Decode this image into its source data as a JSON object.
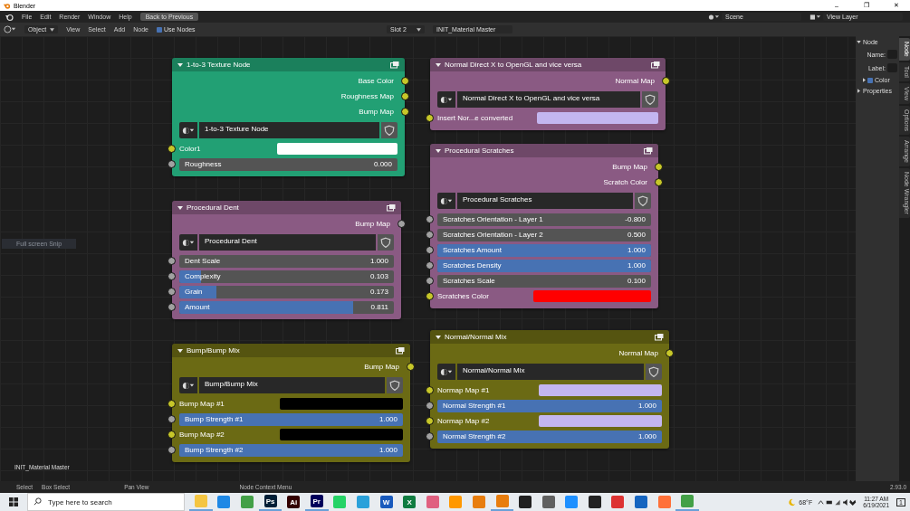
{
  "window": {
    "title": "Blender",
    "controls": [
      "–",
      "❐",
      "✕"
    ]
  },
  "menubar": {
    "items": [
      "File",
      "Edit",
      "Render",
      "Window",
      "Help"
    ],
    "back_button": "Back to Previous"
  },
  "scene": {
    "scene": "Scene",
    "view_layer": "View Layer"
  },
  "header": {
    "mode": "Object",
    "menus": [
      "View",
      "Select",
      "Add",
      "Node"
    ],
    "use_nodes": {
      "label": "Use Nodes",
      "checked": true
    },
    "slot": "Slot 2",
    "material": "INIT_Material Master"
  },
  "canvas": {
    "label": "INIT_Material Master",
    "ghost": "Full screen Snip"
  },
  "nodes": [
    {
      "title": "1-to-3 Texture Node",
      "color": "#22a074",
      "rows": [
        {
          "kind": "output",
          "label": "Base Color",
          "color_socket": true
        },
        {
          "kind": "output",
          "label": "Roughness Map",
          "color_socket": true
        },
        {
          "kind": "output",
          "label": "Bump Map",
          "color_socket": true
        },
        {
          "kind": "group",
          "label": "1-to-3 Texture Node"
        },
        {
          "kind": "color",
          "label": "Color1",
          "color_socket": true,
          "color": "#ffffff"
        },
        {
          "kind": "value",
          "label": "Roughness",
          "value": "0.000",
          "color_socket": false
        }
      ]
    },
    {
      "title": "Procedural Dent",
      "color": "#8a5a83",
      "rows": [
        {
          "kind": "output",
          "label": "Bump Map",
          "color_socket": false
        },
        {
          "kind": "group",
          "label": "Procedural Dent"
        },
        {
          "kind": "value",
          "label": "Dent Scale",
          "value": "1.000",
          "color_socket": false
        },
        {
          "kind": "factor",
          "label": "Complexity",
          "value": "0.103",
          "level": 0.103,
          "color_socket": false
        },
        {
          "kind": "factor",
          "label": "Grain",
          "value": "0.173",
          "level": 0.173,
          "color_socket": false
        },
        {
          "kind": "factor",
          "label": "Amount",
          "value": "0.811",
          "level": 0.811,
          "color_socket": false
        }
      ]
    },
    {
      "title": "Bump/Bump Mix",
      "color": "#6b6a14",
      "rows": [
        {
          "kind": "output",
          "label": "Bump Map",
          "color_socket": true
        },
        {
          "kind": "group",
          "label": "Bump/Bump Mix"
        },
        {
          "kind": "color",
          "label": "Bump Map #1",
          "color_socket": true,
          "color": "#000000"
        },
        {
          "kind": "factor",
          "label": "Bump Strength #1",
          "value": "1.000",
          "level": 1,
          "color_socket": false
        },
        {
          "kind": "color",
          "label": "Bump Map #2",
          "color_socket": true,
          "color": "#000000"
        },
        {
          "kind": "factor",
          "label": "Bump Strength #2",
          "value": "1.000",
          "level": 1,
          "color_socket": false
        }
      ]
    },
    {
      "title": "Normal Direct X to OpenGL and  vice versa",
      "color": "#8a5a83",
      "rows": [
        {
          "kind": "output",
          "label": "Normal Map",
          "color_socket": true
        },
        {
          "kind": "group",
          "label": "Normal Direct X to OpenGL and  vice versa"
        },
        {
          "kind": "color",
          "label": "Insert Nor...e converted",
          "color_socket": true,
          "color": "#c3b6f0"
        }
      ]
    },
    {
      "title": "Procedural Scratches",
      "color": "#8a5a83",
      "rows": [
        {
          "kind": "output",
          "label": "Bump Map",
          "color_socket": true
        },
        {
          "kind": "output",
          "label": "Scratch Color",
          "color_socket": true
        },
        {
          "kind": "group",
          "label": "Procedural Scratches"
        },
        {
          "kind": "value",
          "label": "Scratches Orientation - Layer 1",
          "value": "-0.800",
          "color_socket": false
        },
        {
          "kind": "value",
          "label": "Scratches Orientation - Layer 2",
          "value": "0.500",
          "color_socket": false
        },
        {
          "kind": "factor",
          "label": "Scratches Amount",
          "value": "1.000",
          "level": 1,
          "color_socket": false
        },
        {
          "kind": "factor",
          "label": "Scratches Density",
          "value": "1.000",
          "level": 1,
          "color_socket": false
        },
        {
          "kind": "value",
          "label": "Scratches Scale",
          "value": "0.100",
          "color_socket": false
        },
        {
          "kind": "color",
          "label": "Scratches Color",
          "color_socket": true,
          "color": "#ff0000"
        }
      ]
    },
    {
      "title": "Normal/Normal Mix",
      "color": "#6b6a14",
      "rows": [
        {
          "kind": "output",
          "label": "Normal Map",
          "color_socket": true
        },
        {
          "kind": "group",
          "label": "Normal/Normal Mix"
        },
        {
          "kind": "color",
          "label": "Normap Map #1",
          "color_socket": true,
          "color": "#c3b6f0"
        },
        {
          "kind": "factor",
          "label": "Normal Strength #1",
          "value": "1.000",
          "level": 1,
          "color_socket": false
        },
        {
          "kind": "color",
          "label": "Normap Map #2",
          "color_socket": true,
          "color": "#c3b6f0"
        },
        {
          "kind": "factor",
          "label": "Normal Strength #2",
          "value": "1.000",
          "level": 1,
          "color_socket": false
        }
      ]
    }
  ],
  "sidebar": {
    "section": {
      "label": "Node",
      "expanded": true
    },
    "name_label": "Name:",
    "label_label": "Label:",
    "color": {
      "label": "Color",
      "checked": true,
      "expanded": false
    },
    "properties": {
      "label": "Properties",
      "expanded": false
    },
    "tabs": [
      {
        "label": "Node",
        "selected": true
      },
      {
        "label": "Tool",
        "selected": false
      },
      {
        "label": "View",
        "selected": false
      },
      {
        "label": "Options",
        "selected": false
      },
      {
        "label": "Arrange",
        "selected": false
      },
      {
        "label": "Node Wrangler",
        "selected": false
      }
    ]
  },
  "status_bar": {
    "hints": [
      "Select",
      "Box Select",
      "Pan View",
      "Node Context Menu"
    ],
    "version": "2.93.0"
  },
  "taskbar": {
    "search": {
      "placeholder": "Type here to search"
    },
    "apps": [
      {
        "color": "#f4c542",
        "open": true
      },
      {
        "color": "#1e88e5",
        "open": false
      },
      {
        "color": "#43a047",
        "open": false
      },
      {
        "color": "#001e36",
        "label": "Ps",
        "open": true
      },
      {
        "color": "#330000",
        "label": "Ai",
        "open": false
      },
      {
        "color": "#00005b",
        "label": "Pr",
        "open": true
      },
      {
        "color": "#25d366",
        "open": false
      },
      {
        "color": "#2aa1da",
        "open": false
      },
      {
        "color": "#185abd",
        "label": "W",
        "open": false
      },
      {
        "color": "#107c41",
        "label": "X",
        "open": false
      },
      {
        "color": "#e06080",
        "open": false
      },
      {
        "color": "#ff9800",
        "open": false
      },
      {
        "color": "#e87d0d",
        "open": false
      },
      {
        "color": "#e87d0d",
        "open": true
      },
      {
        "color": "#202020",
        "open": false
      },
      {
        "color": "#606060",
        "open": false
      },
      {
        "color": "#1e90ff",
        "open": false
      },
      {
        "color": "#222222",
        "open": false
      },
      {
        "color": "#dd3333",
        "open": false
      },
      {
        "color": "#1565c0",
        "open": false
      },
      {
        "color": "#ff7139",
        "open": false
      },
      {
        "color": "#43a047",
        "open": true
      }
    ],
    "weather": "68°F",
    "time": "11:27 AM",
    "date": "6/19/2021",
    "notifications": "1"
  }
}
